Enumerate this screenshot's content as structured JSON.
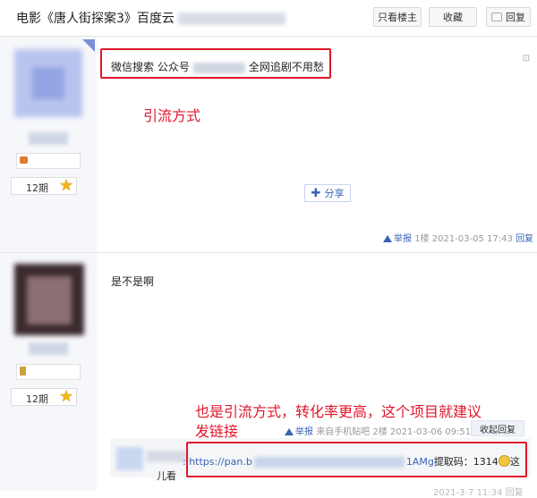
{
  "header": {
    "title": "电影《唐人街探案3》百度云",
    "buttons": {
      "only_op": "只看楼主",
      "favorite": "收藏",
      "reply": "回复"
    }
  },
  "posts": [
    {
      "level": "12期",
      "text_prefix": "微信搜索 公众号",
      "text_suffix": "全网追剧不用愁",
      "annotation": "引流方式",
      "share_label": "分享",
      "meta": {
        "report": "举报",
        "floor": "1楼",
        "time": "2021-03-05 17:43",
        "reply": "回复"
      }
    },
    {
      "level": "12期",
      "text": "是不是啊",
      "annotation_line1": "也是引流方式，转化率更高，这个项目就建议",
      "annotation_line2": "发链接",
      "meta": {
        "report": "举报",
        "source": "来自手机贴吧",
        "floor": "2楼",
        "time": "2021-03-06 09:51",
        "fold": "收起回复"
      },
      "subreply": {
        "link_prefix": ": https://pan.b",
        "link_suffix": "1AMg",
        "code_text": "提取码：1314",
        "tail": "这",
        "wrap": "儿看"
      },
      "bottom_meta": "2021-3-7 11:34 回复"
    }
  ],
  "colors": {
    "annotation_red": "#e0162b",
    "link_blue": "#3863b5",
    "star_gold": "#f2b51c"
  }
}
